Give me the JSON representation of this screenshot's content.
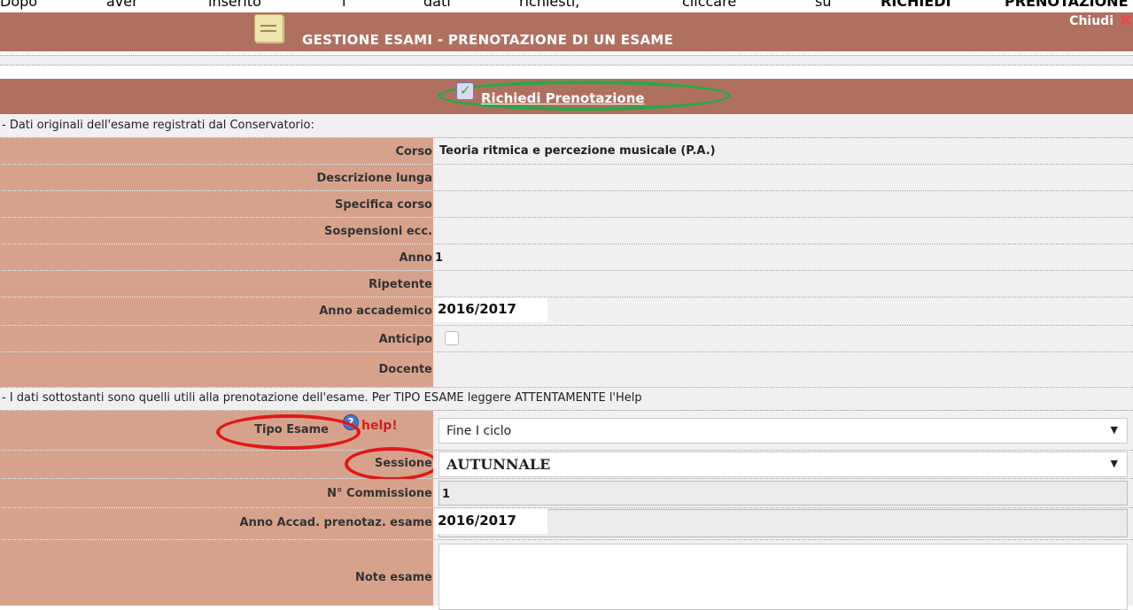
{
  "instruction": {
    "w1": "Dopo",
    "w2": "aver",
    "w3": "inserito",
    "w4": "i",
    "w5": "dati",
    "w6": "richiesti,",
    "w7": "cliccare",
    "w8": "su",
    "w9": "RICHIEDI",
    "w10": "PRENOTAZIONE"
  },
  "header": {
    "title": "GESTIONE ESAMI - PRENOTAZIONE DI UN ESAME",
    "close_label": "Chiudi"
  },
  "action": {
    "request_label": "Richiedi Prenotazione"
  },
  "sections": {
    "original_data": "- Dati originali dell'esame registrati dal Conservatorio:",
    "booking_data": "- I dati sottostanti sono quelli utili alla prenotazione dell'esame. Per TIPO ESAME leggere ATTENTAMENTE l'Help"
  },
  "original_fields": {
    "corso": {
      "label": "Corso",
      "value": "Teoria ritmica e percezione musicale (P.A.)"
    },
    "descrizione": {
      "label": "Descrizione lunga",
      "value": ""
    },
    "specifica": {
      "label": "Specifica corso",
      "value": ""
    },
    "sospensioni": {
      "label": "Sospensioni ecc.",
      "value": ""
    },
    "anno": {
      "label": "Anno",
      "value": "1"
    },
    "ripetente": {
      "label": "Ripetente",
      "value": ""
    },
    "anno_accademico": {
      "label": "Anno accademico",
      "value": "2016/2017"
    },
    "anticipo": {
      "label": "Anticipo",
      "checked": false
    },
    "docente": {
      "label": "Docente",
      "value": ""
    }
  },
  "booking_fields": {
    "tipo_esame": {
      "label": "Tipo Esame",
      "help": "help!",
      "value": "Fine I ciclo"
    },
    "sessione": {
      "label": "Sessione",
      "value": "AUTUNNALE"
    },
    "commissione": {
      "label": "N° Commissione",
      "value": "1"
    },
    "anno_accad_prenot": {
      "label": "Anno Accad. prenotaz. esame",
      "value": "2016/2017"
    },
    "note": {
      "label": "Note esame",
      "value": ""
    }
  },
  "icons": {
    "title": "notepad-icon",
    "close": "close-icon",
    "request": "checklist-icon",
    "help": "help-icon",
    "dropdown": "chevron-down-icon"
  },
  "colors": {
    "header_bg": "#b07060",
    "label_bg": "#d7a28c",
    "value_bg": "#f1efef",
    "highlight_green": "#2aa745",
    "highlight_red": "#e01818"
  }
}
